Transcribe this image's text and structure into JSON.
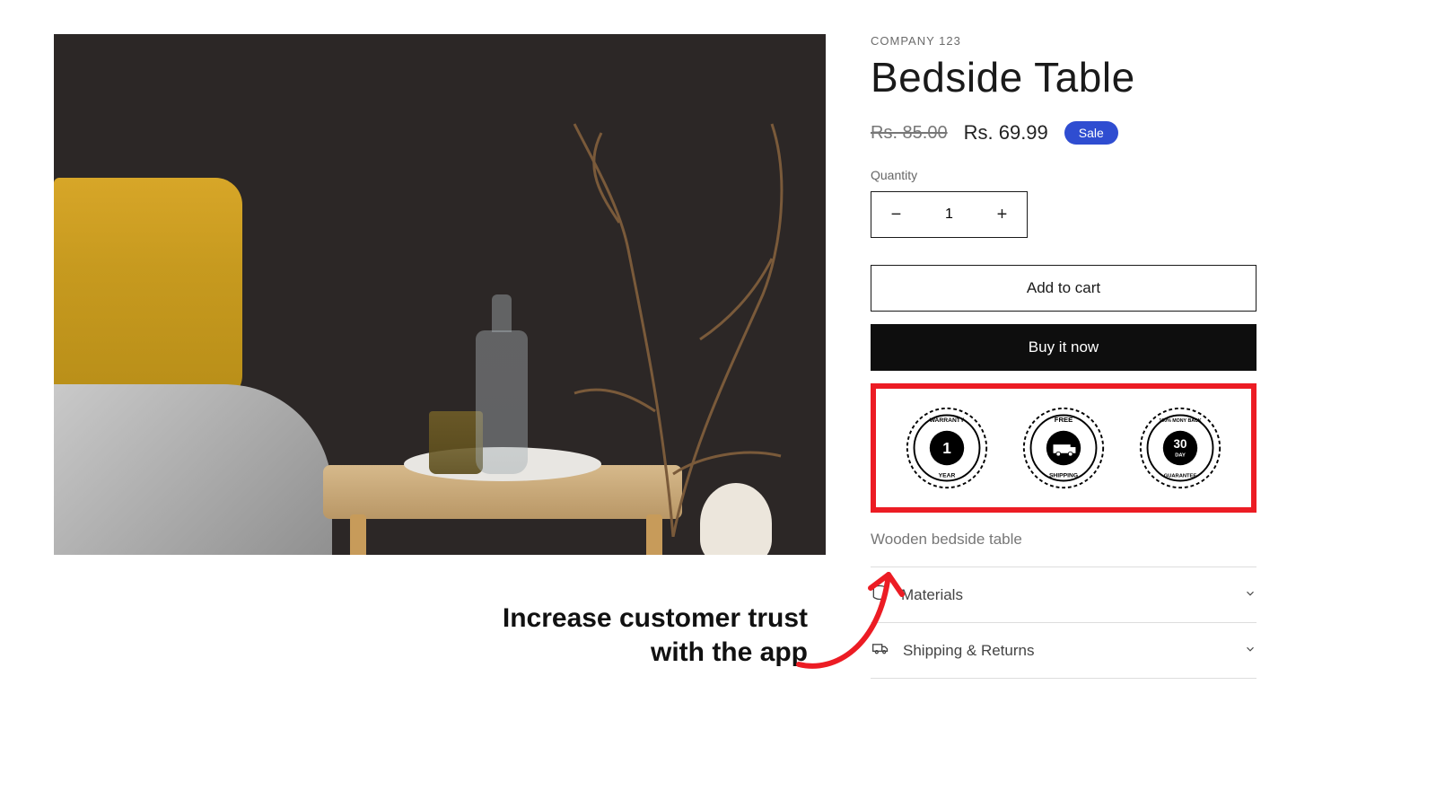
{
  "vendor": "COMPANY 123",
  "title": "Bedside Table",
  "price_old": "Rs. 85.00",
  "price_new": "Rs. 69.99",
  "sale_label": "Sale",
  "quantity_label": "Quantity",
  "quantity_value": "1",
  "add_to_cart": "Add to cart",
  "buy_now": "Buy it now",
  "badges": [
    {
      "top": "WARRANTY",
      "center_top": "1",
      "center_bottom": "",
      "bottom": "YEAR"
    },
    {
      "top": "FREE",
      "center_top": "",
      "center_bottom": "",
      "bottom": "SHIPPING"
    },
    {
      "top": "100% MONY BACK",
      "center_top": "30",
      "center_bottom": "DAY",
      "bottom": "GUARANTEE"
    }
  ],
  "description": "Wooden bedside table",
  "accordion": {
    "materials": "Materials",
    "shipping": "Shipping & Returns"
  },
  "annotation_line1": "Increase customer trust",
  "annotation_line2": "with the app"
}
